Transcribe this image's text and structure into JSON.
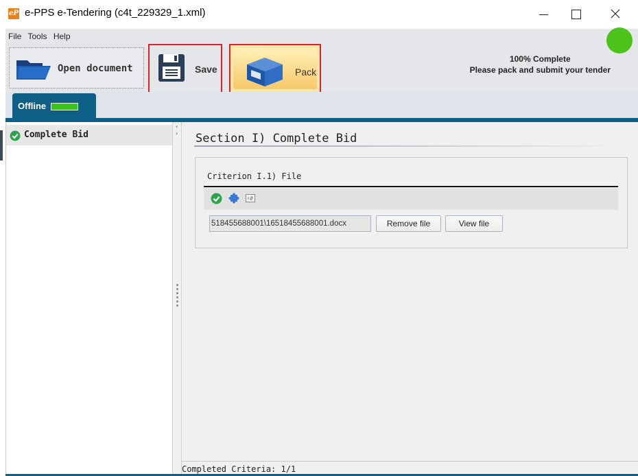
{
  "window": {
    "title": "e-PPS e-Tendering (c4t_229329_1.xml)",
    "app_icon_text": "eP",
    "controls": [
      "minimize-icon",
      "maximize-icon",
      "close-icon"
    ]
  },
  "menu": {
    "items": [
      {
        "label": "File"
      },
      {
        "label": "Tools"
      },
      {
        "label": "Help"
      }
    ]
  },
  "toolbar": {
    "open_label": "Open document",
    "save_label": "Save",
    "pack_label": "Pack",
    "highlight_color": "#e0202a"
  },
  "status": {
    "line1": "100% Complete",
    "line2": "Please pack and submit your tender",
    "indicator_color": "#4cc31a"
  },
  "tabs": [
    {
      "label": "Offline",
      "status_color": "#38c21a"
    }
  ],
  "tree": {
    "items": [
      {
        "label": "Complete Bid",
        "icon": "check-circle-icon",
        "selected": true
      }
    ]
  },
  "section": {
    "title": "Section I) Complete Bid",
    "criterion": {
      "title": "Criterion I.1) File",
      "icons": [
        "check-circle-icon",
        "puzzle-icon",
        "numbered-list-icon"
      ],
      "file_value": "518455688001\\16518455688001.docx",
      "remove_label": "Remove file",
      "view_label": "View file"
    }
  },
  "statusbar": {
    "text": "Completed Criteria: 1/1"
  },
  "colors": {
    "accent": "#0e5f86",
    "success": "#2ea44f"
  }
}
